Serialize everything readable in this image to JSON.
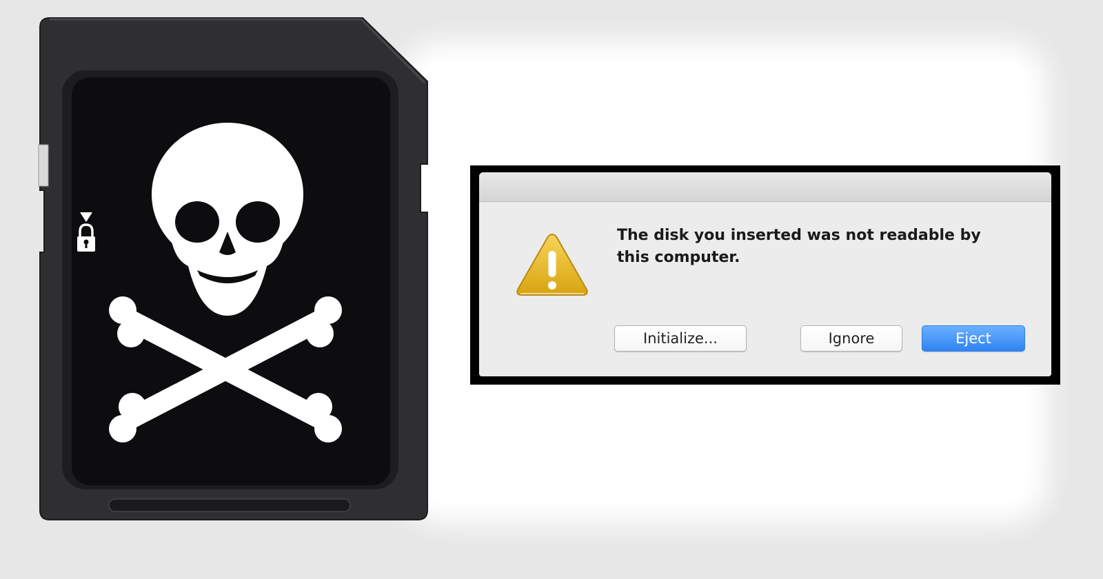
{
  "sd_card": {
    "emblem_icon": "skull-and-crossbones-icon",
    "lock_icon": "padlock-icon",
    "arrow_icon": "triangle-down-icon",
    "body_color": "#2f2f31",
    "label_color": "#0d0d10"
  },
  "dialog": {
    "alert_icon": "warning-triangle-icon",
    "accent_color": "#e2b21f",
    "message": "The disk you inserted was not readable by this computer.",
    "buttons": {
      "initialize": "Initialize...",
      "ignore": "Ignore",
      "eject": "Eject"
    },
    "default_button_color": "#2f83f5"
  }
}
